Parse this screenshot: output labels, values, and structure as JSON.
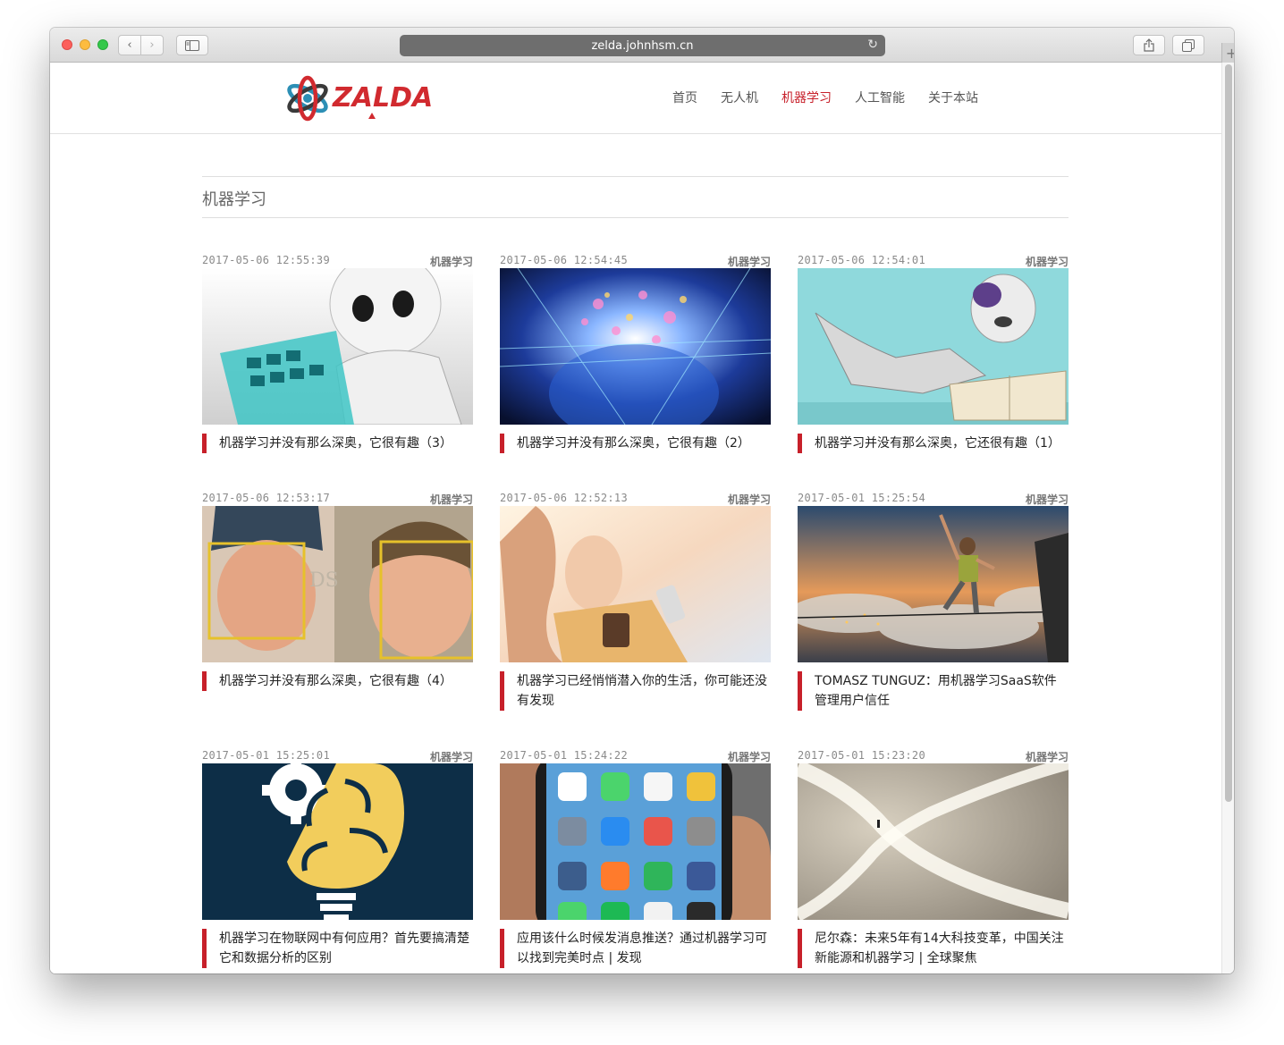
{
  "browser": {
    "url": "zelda.johnhsm.cn",
    "nav_back": "‹",
    "nav_forward": "›",
    "reload_icon": "↻",
    "share_icon": "⇪",
    "tabs_icon": "⧉",
    "new_tab": "+"
  },
  "site": {
    "logo_text": "ZALDA",
    "nav": [
      {
        "label": "首页",
        "active": false
      },
      {
        "label": "无人机",
        "active": false
      },
      {
        "label": "机器学习",
        "active": true
      },
      {
        "label": "人工智能",
        "active": false
      },
      {
        "label": "关于本站",
        "active": false
      }
    ],
    "accent_color": "#c7202a"
  },
  "page": {
    "category_title": "机器学习"
  },
  "posts": [
    {
      "date": "2017-05-06 12:55:39",
      "category": "机器学习",
      "title": "机器学习并没有那么深奥，它很有趣（3）"
    },
    {
      "date": "2017-05-06 12:54:45",
      "category": "机器学习",
      "title": "机器学习并没有那么深奥，它很有趣（2）"
    },
    {
      "date": "2017-05-06 12:54:01",
      "category": "机器学习",
      "title": "机器学习并没有那么深奥，它还很有趣（1）"
    },
    {
      "date": "2017-05-06 12:53:17",
      "category": "机器学习",
      "title": "机器学习并没有那么深奥，它很有趣（4）"
    },
    {
      "date": "2017-05-06 12:52:13",
      "category": "机器学习",
      "title": "机器学习已经悄悄潜入你的生活，你可能还没有发现"
    },
    {
      "date": "2017-05-01 15:25:54",
      "category": "机器学习",
      "title": "TOMASZ TUNGUZ：用机器学习SaaS软件管理用户信任"
    },
    {
      "date": "2017-05-01 15:25:01",
      "category": "机器学习",
      "title": "机器学习在物联网中有何应用？首先要搞清楚它和数据分析的区别"
    },
    {
      "date": "2017-05-01 15:24:22",
      "category": "机器学习",
      "title": "应用该什么时候发消息推送？通过机器学习可以找到完美时点 | 发现"
    },
    {
      "date": "2017-05-01 15:23:20",
      "category": "机器学习",
      "title": "尼尔森：未来5年有14大科技变革，中国关注新能源和机器学习 | 全球聚焦"
    }
  ]
}
